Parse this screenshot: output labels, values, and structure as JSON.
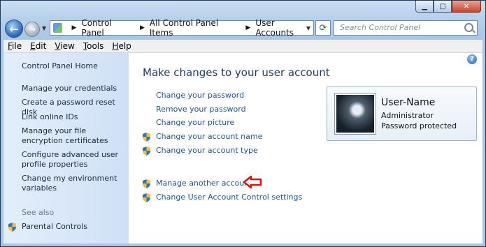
{
  "window": {
    "caption_buttons": [
      "minimize",
      "maximize",
      "close"
    ]
  },
  "nav": {
    "breadcrumb": [
      "Control Panel",
      "All Control Panel Items",
      "User Accounts"
    ],
    "search_placeholder": "Search Control Panel"
  },
  "menu": {
    "items": [
      {
        "label": "File",
        "accel": "F",
        "rest": "ile"
      },
      {
        "label": "Edit",
        "accel": "E",
        "rest": "dit"
      },
      {
        "label": "View",
        "accel": "V",
        "rest": "iew"
      },
      {
        "label": "Tools",
        "accel": "T",
        "rest": "ools"
      },
      {
        "label": "Help",
        "accel": "H",
        "rest": "elp"
      }
    ]
  },
  "sidebar": {
    "home": "Control Panel Home",
    "items": [
      "Manage your credentials",
      "Create a password reset disk",
      "Link online IDs",
      "Manage your file encryption certificates",
      "Configure advanced user profile properties",
      "Change my environment variables"
    ],
    "see_also_label": "See also",
    "see_also": [
      "Parental Controls"
    ]
  },
  "main": {
    "title": "Make changes to your user account",
    "links": [
      {
        "label": "Change your password",
        "shield": false
      },
      {
        "label": "Remove your password",
        "shield": false
      },
      {
        "label": "Change your picture",
        "shield": false
      },
      {
        "label": "Change your account name",
        "shield": true
      },
      {
        "label": "Change your account type",
        "shield": true
      }
    ],
    "links2": [
      {
        "label": "Manage another account",
        "shield": true
      },
      {
        "label": "Change User Account Control settings",
        "shield": true
      }
    ]
  },
  "user": {
    "name": "User-Name",
    "role": "Administrator",
    "status": "Password protected"
  },
  "colors": {
    "link": "#1a56a0",
    "title": "#1e3a6e",
    "annotation_arrow": "#e01010"
  }
}
